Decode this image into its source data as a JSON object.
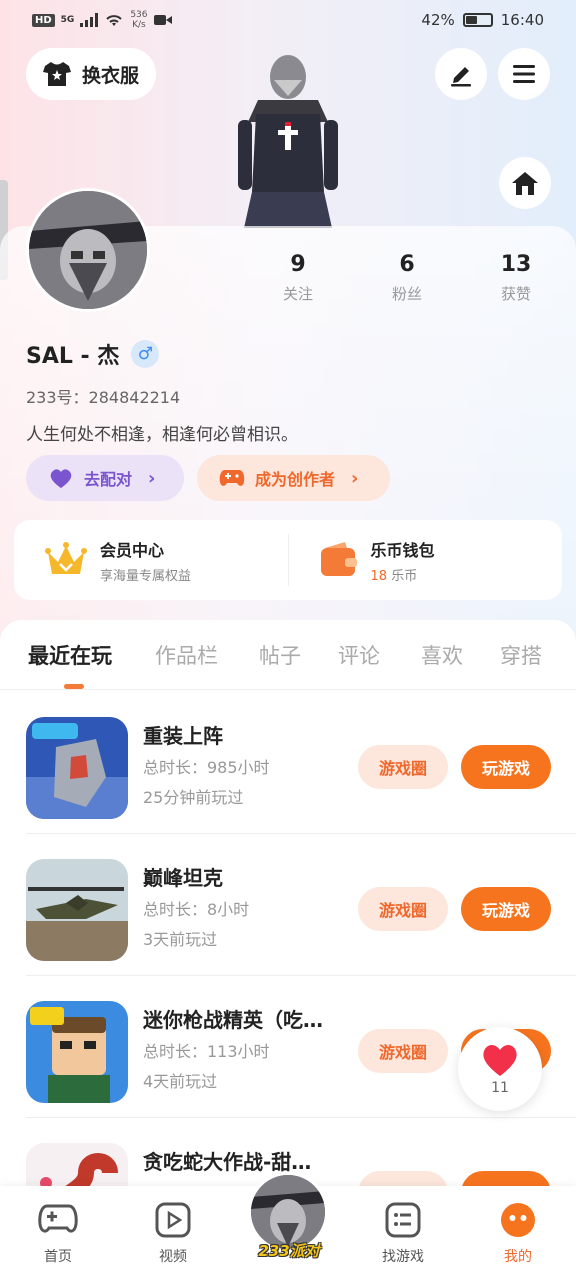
{
  "status_bar": {
    "hd": "HD",
    "network": "5G",
    "speed_value": "536",
    "speed_unit": "K/s",
    "battery": "42%",
    "time": "16:40"
  },
  "header": {
    "wardrobe_label": "换衣服"
  },
  "profile": {
    "following_count": "9",
    "following_label": "关注",
    "fans_count": "6",
    "fans_label": "粉丝",
    "likes_count": "13",
    "likes_label": "获赞",
    "username": "SAL - 杰",
    "gender_symbol": "♂",
    "uid": "233号：284842214",
    "bio": "人生何处不相逢，相逢何必曾相识。",
    "pair_label": "去配对",
    "creator_label": "成为创作者"
  },
  "member": {
    "vip_title": "会员中心",
    "vip_sub": "享海量专属权益",
    "wallet_title": "乐币钱包",
    "wallet_amount": "18",
    "wallet_unit": "乐币"
  },
  "tabs": [
    {
      "label": "最近在玩"
    },
    {
      "label": "作品栏"
    },
    {
      "label": "帖子"
    },
    {
      "label": "评论"
    },
    {
      "label": "喜欢"
    },
    {
      "label": "穿搭"
    }
  ],
  "games": [
    {
      "name": "重装上阵",
      "time": "总时长：985小时",
      "last": "25分钟前玩过",
      "circle_label": "游戏圈",
      "play_label": "玩游戏"
    },
    {
      "name": "巅峰坦克",
      "time": "总时长：8小时",
      "last": "3天前玩过",
      "circle_label": "游戏圈",
      "play_label": "玩游戏"
    },
    {
      "name": "迷你枪战精英（吃…",
      "time": "总时长：113小时",
      "last": "4天前玩过",
      "circle_label": "游戏圈",
      "play_label": "玩游戏"
    },
    {
      "name": "贪吃蛇大作战-甜…",
      "time": "",
      "last": "",
      "circle_label": "游戏圈",
      "play_label": "玩游戏"
    }
  ],
  "like_float": {
    "count": "11"
  },
  "bottom_nav": {
    "home": "首页",
    "video": "视频",
    "center": "233派对",
    "find": "找游戏",
    "mine": "我的"
  },
  "colors": {
    "accent": "#f7741f",
    "accent_light": "#fde6dc",
    "purple": "#7a55cf",
    "blue": "#3d8bf2"
  }
}
